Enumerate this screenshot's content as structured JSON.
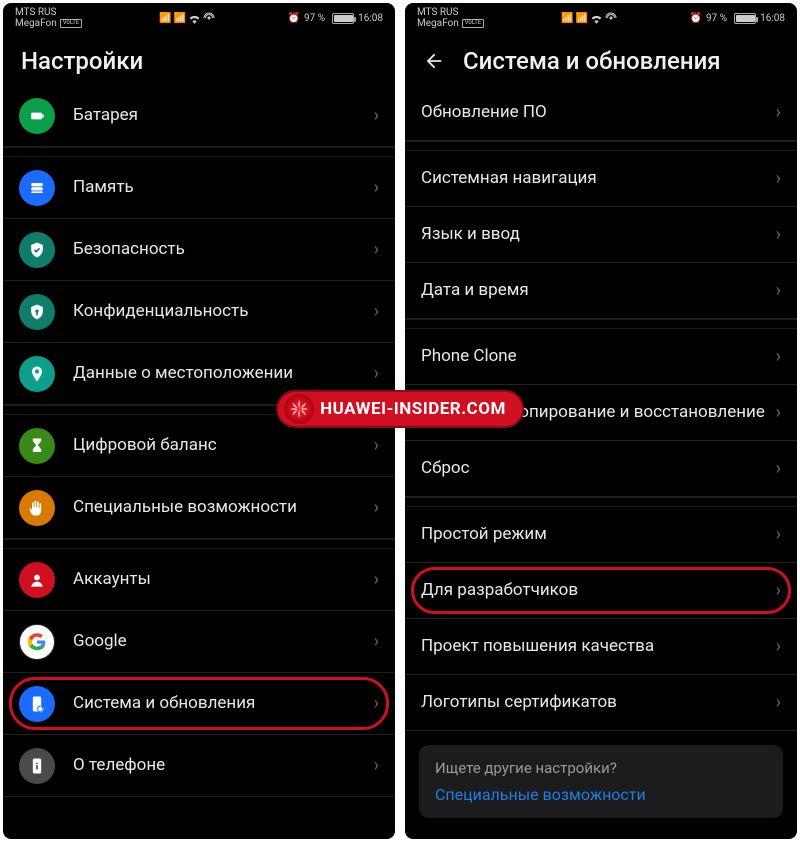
{
  "status": {
    "carrier1": "MTS RUS",
    "carrier2": "MegaFon",
    "battery_pct": "97 %",
    "time": "16:08"
  },
  "left": {
    "title": "Настройки",
    "items": [
      {
        "key": "battery",
        "label": "Батарея",
        "color": "#0aa04a",
        "icon": "battery"
      },
      {
        "key": "storage",
        "label": "Память",
        "color": "#1b6bff",
        "icon": "storage",
        "gap_before": true
      },
      {
        "key": "security",
        "label": "Безопасность",
        "color": "#0e7e6b",
        "icon": "shield"
      },
      {
        "key": "privacy",
        "label": "Конфиденциальность",
        "color": "#0e7e6b",
        "icon": "privacy"
      },
      {
        "key": "location",
        "label": "Данные о местоположении",
        "color": "#0e9e8e",
        "icon": "pin"
      },
      {
        "key": "wellbeing",
        "label": "Цифровой баланс",
        "color": "#3a8a1a",
        "icon": "hourglass",
        "gap_before": true
      },
      {
        "key": "a11y",
        "label": "Специальные возможности",
        "color": "#d97a00",
        "icon": "hand"
      },
      {
        "key": "accounts",
        "label": "Аккаунты",
        "color": "#d01020",
        "icon": "user",
        "gap_before": true
      },
      {
        "key": "google",
        "label": "Google",
        "color": "#ffffff",
        "icon": "google"
      },
      {
        "key": "system",
        "label": "Система и обновления",
        "color": "#1b6bff",
        "icon": "phone-gear",
        "highlight": true
      },
      {
        "key": "about",
        "label": "О телефоне",
        "color": "#4a4a4a",
        "icon": "phone-info"
      }
    ]
  },
  "right": {
    "title": "Система и обновления",
    "items": [
      {
        "label": "Обновление ПО"
      },
      {
        "label": "Системная навигация",
        "gap_before": true
      },
      {
        "label": "Язык и ввод"
      },
      {
        "label": "Дата и время"
      },
      {
        "label": "Phone Clone",
        "gap_before": true
      },
      {
        "label": "Резервное копирование и восстановление"
      },
      {
        "label": "Сброс"
      },
      {
        "label": "Простой режим",
        "gap_before": true
      },
      {
        "label": "Для разработчиков",
        "highlight": true
      },
      {
        "label": "Проект повышения качества"
      },
      {
        "label": "Логотипы сертификатов"
      }
    ],
    "footer_q": "Ищете другие настройки?",
    "footer_link": "Специальные возможности"
  },
  "watermark": "HUAWEI-INSIDER.COM"
}
